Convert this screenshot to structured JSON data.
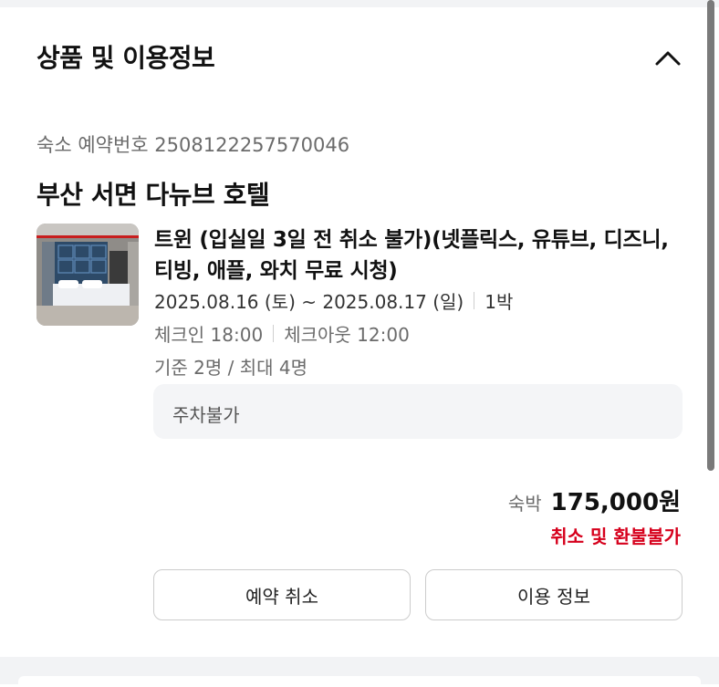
{
  "section": {
    "title": "상품 및 이용정보"
  },
  "reservation": {
    "label": "숙소 예약번호",
    "number": "2508122257570046"
  },
  "hotel": {
    "name": "부산 서면 다뉴브 호텔"
  },
  "room": {
    "name": "트윈 (입실일 3일 전 취소 불가)(넷플릭스, 유튜브, 디즈니, 티빙, 애플, 와치 무료 시청)",
    "dates": "2025.08.16 (토) ~ 2025.08.17 (일)",
    "nights": "1박",
    "checkin": "체크인 18:00",
    "checkout": "체크아웃 12:00",
    "occupancy": "기준 2명 / 최대 4명",
    "parking": "주차불가"
  },
  "price": {
    "label": "숙박",
    "amount": "175,000원",
    "refund_policy": "취소 및 환불불가"
  },
  "buttons": {
    "cancel": "예약 취소",
    "info": "이용 정보"
  },
  "colors": {
    "accent_red": "#d6001c",
    "panel_gray": "#f4f5f7"
  }
}
